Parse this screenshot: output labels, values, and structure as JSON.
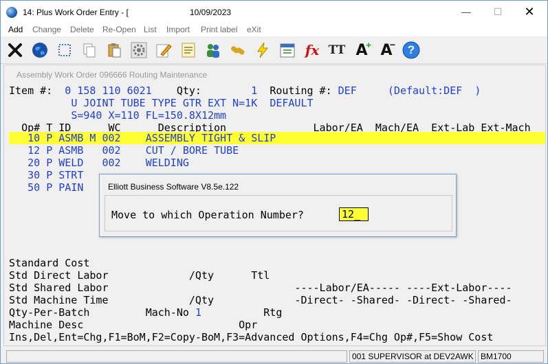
{
  "window": {
    "title": "14: Plus Work Order Entry - [",
    "date": "10/09/2023",
    "minimize_glyph": "—",
    "maximize_glyph": "☐",
    "close_glyph": "✕"
  },
  "menu": [
    "Add",
    "Change",
    "Delete",
    "Re-Open",
    "List",
    "Import",
    "Print label",
    "eXit"
  ],
  "toolbar": {
    "icons": [
      "close-x-icon",
      "globe-icon",
      "select-box-icon",
      "copy-icon",
      "paste-icon",
      "settings-gear-icon",
      "edit-pencil-icon",
      "notes-icon",
      "users-icon",
      "link-icon",
      "lightning-icon",
      "calendar-icon",
      "function-fx-icon",
      "font-size-icon",
      "increase-font-icon",
      "decrease-font-icon",
      "help-icon"
    ],
    "fx_label": "fx",
    "tt_label": "TT",
    "a_label": "A",
    "help_label": "?"
  },
  "screen": {
    "caption": "Assembly Work Order 096666 Routing Maintenance",
    "item_label": "Item #:",
    "item_value": "0 158 110 6021",
    "qty_label": "Qty:",
    "qty_value": "1",
    "routing_label": "Routing #:",
    "routing_value": "DEF",
    "default_text": "(Default:DEF  )",
    "desc1": "U JOINT TUBE TYPE GTR EXT N=1K",
    "desc1_default": "DEFAULT",
    "desc2": "S=940 X=110 FL=150.8X12mm",
    "headers": {
      "op": "Op#",
      "t": "T",
      "id": "ID",
      "wc": "WC",
      "description": "Description",
      "labor": "Labor/EA",
      "mach": "Mach/EA",
      "ext_lab": "Ext-Lab",
      "ext_mach": "Ext-Mach"
    },
    "rows": [
      {
        "op": "10",
        "t": "P",
        "id": "ASMB",
        "m": "M",
        "wc": "002",
        "desc": "ASSEMBLY TIGHT & SLIP"
      },
      {
        "op": "12",
        "t": "P",
        "id": "ASMB",
        "m": "",
        "wc": "002",
        "desc": "CUT / BORE TUBE"
      },
      {
        "op": "20",
        "t": "P",
        "id": "WELD",
        "m": "",
        "wc": "002",
        "desc": "WELDING"
      },
      {
        "op": "30",
        "t": "P",
        "id": "STRT",
        "m": "",
        "wc": "",
        "desc": ""
      },
      {
        "op": "50",
        "t": "P",
        "id": "PAIN",
        "m": "",
        "wc": "",
        "desc": ""
      }
    ],
    "standard_cost": "Standard Cost",
    "std_direct_labor": "Std Direct Labor",
    "per_qty_1": "/Qty",
    "ttl": "Ttl",
    "std_shared_labor": "Std Shared Labor",
    "labor_ea_hdr": "----Labor/EA-----",
    "ext_labor_hdr": "----Ext-Labor----",
    "std_machine_time": "Std Machine Time",
    "per_qty_2": "/Qty",
    "direct_1": "-Direct-",
    "shared_1": "-Shared-",
    "direct_2": "-Direct-",
    "shared_2": "-Shared-",
    "qty_per_batch": "Qty-Per-Batch",
    "mach_no_label": "Mach-No",
    "mach_no_value": "1",
    "rtg": "Rtg",
    "machine_desc": "Machine Desc",
    "opr": "Opr",
    "help_line": "Ins,Del,Ent=Chg,F1=BoM,F2=Copy-BoM,F3=Advanced Options,F4=Chg Op#,F5=Show Cost"
  },
  "dialog": {
    "title": "Elliott Business Software V8.5e.122",
    "prompt": "Move to which Operation Number?",
    "input_value": "12_"
  },
  "status": {
    "user": "001 SUPERVISOR at DEV2AWK",
    "module": "BM1700"
  }
}
